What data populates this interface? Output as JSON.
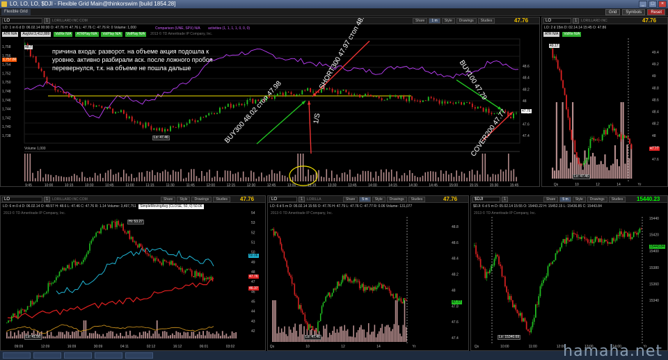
{
  "window": {
    "title": "LO, LO, LO, $DJI - Flexible Grid Main@thinkorswim [build 1854.28]",
    "grid_tab": "Flexible Grid",
    "buttons": [
      "Grid",
      "Symbols",
      "Reset"
    ]
  },
  "main": {
    "symbol": "LO",
    "company": "LORILLARD INC COM",
    "period": "1 m",
    "share": "Share",
    "style": "Style",
    "drawings": "Drawings",
    "studies": "Studies",
    "last": "47.76",
    "quote": "LO: 1 m 6 d  D: 06.02.14 00:00  O: 47.76  H: 47.76  L: 47.76  C: 47.76  R: 0  Volume: 1,000",
    "badges": [
      "ATR N/A",
      "AvgVol 3,412,889",
      "VolRe N/A",
      "ATRPlay N/A",
      "VolPlay N/A",
      "VolPlay N/A"
    ],
    "copyright": "2013 © TD Ameritrade IP Company, Inc.",
    "comparison": "Comparison (UNE, SPX)  N/A",
    "activities": "activities (1, 1, 1, 1, 0, 0, 0)",
    "volume_header": "Volume  1,000",
    "lo_label": "Lo: 47.46",
    "tag_price_left": "1,757.86",
    "tag_price_top": "48.7",
    "tag_47_76": "47.76",
    "y_left": [
      "1,758",
      "1,756",
      "1,754",
      "1,752",
      "1,750",
      "1,748",
      "1,746",
      "1,744",
      "1,742",
      "1,740",
      "1,738"
    ],
    "y_right": [
      "48.6",
      "48.4",
      "48.2",
      "48",
      "47.8",
      "47.6",
      "47.4"
    ],
    "x_labels": [
      "9:45",
      "10:00",
      "10:15",
      "10:30",
      "10:45",
      "11:00",
      "11:15",
      "11:30",
      "11:45",
      "12:00",
      "12:15",
      "12:30",
      "12:45",
      "13:00",
      "13:15",
      "13:30",
      "13:45",
      "14:00",
      "14:15",
      "14:30",
      "14:45",
      "15:00",
      "15:15",
      "15:30",
      "15:45"
    ],
    "annotation_text": [
      "причина входа: разворот. на объеме акция подошла к",
      "уровню. активно разбирали аск. после ложного пробоя",
      "перевернулся, т.к. на объеме не пошла дальше"
    ],
    "label_buy300": "BUY300 48.02 стоп 47.98",
    "label_short300": "SHORT300 47.97 стоп 48.04",
    "label_buy100": "BUY100 47.79",
    "label_cover200": "COVER200 47.77",
    "label_1s": "1/S"
  },
  "top_right": {
    "symbol": "LO",
    "company": "LORILLARD INC",
    "last": "47.76",
    "quote": "LO: 2 d 15m  D: 02.14.14 15:45  O: 47.86",
    "badges": [
      "ATR N/A",
      "VolRe N/A"
    ],
    "y_labels": [
      "49.4",
      "49.2",
      "49",
      "48.8",
      "48.6",
      "48.4",
      "48.2",
      "48",
      "47.8",
      "47.6"
    ],
    "price_tag": "47.77",
    "tag_top": "49.17",
    "lo_label": "Lo: 47.46",
    "x_labels": [
      "Qs",
      "10",
      "12",
      "14",
      "Yr"
    ]
  },
  "bottom_left": {
    "symbol": "LO",
    "company": "LORILLARD INC COM",
    "last": "47.76",
    "quote": "LO: 6 m 0 d  D: 06.02.14  O: 48.57  H: 48.6  L: 47.46  C: 47.76  R: 1.14  Volume: 3,497,751",
    "sma": "SimpleMovingAvg (CLOSE, 50, 0)  50.06",
    "copyright": "2013 © TD Ameritrade IP Company, Inc.",
    "hi_label": "Hi: 53.27",
    "lo_label": "Lo: 41.56",
    "tags": [
      "50.06",
      "47.76",
      "46.37"
    ],
    "y_labels": [
      "54",
      "53",
      "52",
      "51",
      "50",
      "49",
      "48",
      "47",
      "46",
      "45",
      "44",
      "43",
      "42"
    ],
    "x_labels": [
      "09:09",
      "12:09",
      "16:09",
      "30:09",
      "04:11",
      "02:12",
      "16:12",
      "06:01",
      "03:02"
    ]
  },
  "bottom_mid": {
    "symbol": "LO",
    "company": "LORILLA",
    "period": "5 m",
    "last": "47.76",
    "quote": "LO: 6 d 5 m  D: 05.02.14 15:55  O: 47.76  H: 47.79  L: 47.76  C: 47.77  R: 0.06  Volume: 131,077",
    "copyright": "2013 © TD Ameritrade IP Company, Inc.",
    "tag": "47.77",
    "lo_label": "Lo: 47.46",
    "y_labels": [
      "48.8",
      "48.6",
      "48.4",
      "48.2",
      "48",
      "47.8",
      "47.6",
      "47.4"
    ],
    "x_labels": [
      "Qs",
      "10",
      "12",
      "14",
      "Yr"
    ]
  },
  "bottom_right": {
    "symbol": "$DJI",
    "company": "",
    "period": "5 m",
    "last": "15440.23",
    "quote": "$DJI: 6 d 5 m  D: 05.02.14 15:55  O: 15443.22  H: 15452.15  L: 15436.85  C: 15443.84",
    "copyright": "2013 © TD Ameritrade IP Company, Inc.",
    "tag": "15443.84",
    "lo_label": "Lo: 15340.69",
    "y_labels": [
      "15440",
      "15420",
      "15400",
      "15380",
      "15360",
      "15340"
    ],
    "x_labels": [
      "Qs",
      "10:00",
      "11:00",
      "12:00",
      "13:00",
      "14:00",
      "Yr"
    ]
  },
  "watermark": "hamaha.net",
  "colors": {
    "up": "#22c222",
    "down": "#dd2222",
    "comparison": "#c040ff",
    "level": "#f0e000",
    "volume": "#b48c8c",
    "sma_cyan": "#20b8d8",
    "sma_red": "#e02020"
  }
}
